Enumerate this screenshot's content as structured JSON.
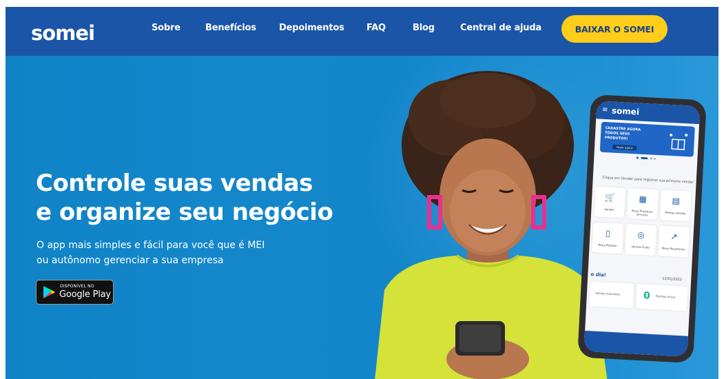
{
  "header": {
    "logo_text": "somei",
    "nav": [
      {
        "label": "Sobre"
      },
      {
        "label": "Benefícios"
      },
      {
        "label": "Depoimentos"
      },
      {
        "label": "FAQ"
      },
      {
        "label": "Blog"
      },
      {
        "label": "Central de ajuda"
      }
    ],
    "cta_label": "BAIXAR O SOMEI"
  },
  "hero": {
    "headline_line1": "Controle suas vendas",
    "headline_line2": "e organize seu negócio",
    "sub_line1": "O app mais simples e fácil para você que é MEI",
    "sub_line2": "ou autônomo gerenciar a sua empresa",
    "google_play": {
      "small": "DISPONÍVEL NO",
      "big": "Google Play"
    }
  },
  "phone": {
    "app_logo": "somei",
    "banner_text": "CADASTRE AGORA TODOS SEUS PRODUTOS!",
    "banner_button": "Fazer agora",
    "hint": "Clique em Vender para registrar sua primeira venda!",
    "tiles": [
      {
        "label": "Vender",
        "icon": "cart-icon"
      },
      {
        "label": "Meus Produtos/ Serviços",
        "icon": "grid-icon"
      },
      {
        "label": "Minhas Vendas",
        "icon": "receipt-icon"
      },
      {
        "label": "Meus Pedidos",
        "icon": "document-icon"
      },
      {
        "label": "Vendas Fiado",
        "icon": "handshake-icon"
      },
      {
        "label": "Meus Resultados",
        "icon": "trend-icon"
      }
    ],
    "greeting": "o dia!",
    "date": "12/01/2022",
    "card1_label": "Vendas realizadas",
    "card2_number": "0",
    "card2_label": "Pedidos ativos"
  },
  "colors": {
    "navbar": "#1a55a8",
    "hero_bg": "#1386ca",
    "cta_bg": "#ffcd1a",
    "cta_text": "#1d3f86",
    "shirt": "#d4e23a"
  }
}
